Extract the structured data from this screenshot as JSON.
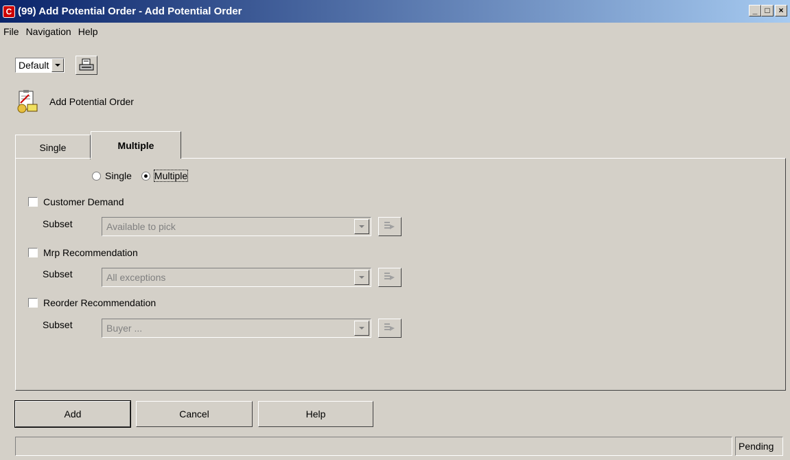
{
  "window": {
    "title": "(99) Add Potential Order - Add Potential Order",
    "minimize": "_",
    "maximize": "□",
    "close": "×"
  },
  "menu": [
    "File",
    "Navigation",
    "Help"
  ],
  "toolbar": {
    "layout_value": "Default",
    "print_icon": "printer-icon"
  },
  "header": {
    "icon": "order-document-icon",
    "title": "Add Potential Order"
  },
  "tabs": [
    {
      "label": "Single",
      "active": false
    },
    {
      "label": "Multiple",
      "active": true
    }
  ],
  "mode": {
    "options": [
      "Single",
      "Multiple"
    ],
    "selected": "Multiple"
  },
  "sections": [
    {
      "label": "Customer Demand",
      "checked": false,
      "subset_label": "Subset",
      "subset_value": "Available to pick"
    },
    {
      "label": "Mrp Recommendation",
      "checked": false,
      "subset_label": "Subset",
      "subset_value": "All exceptions"
    },
    {
      "label": "Reorder Recommendation",
      "checked": false,
      "subset_label": "Subset",
      "subset_value": "Buyer ..."
    }
  ],
  "buttons": {
    "add": "Add",
    "cancel": "Cancel",
    "help": "Help"
  },
  "status": {
    "main": "",
    "right": "Pending"
  },
  "colors": {
    "titlebar_start": "#0a246a",
    "titlebar_end": "#a6caf0",
    "face": "#d4d0c8",
    "app_icon": "#cc0000"
  }
}
